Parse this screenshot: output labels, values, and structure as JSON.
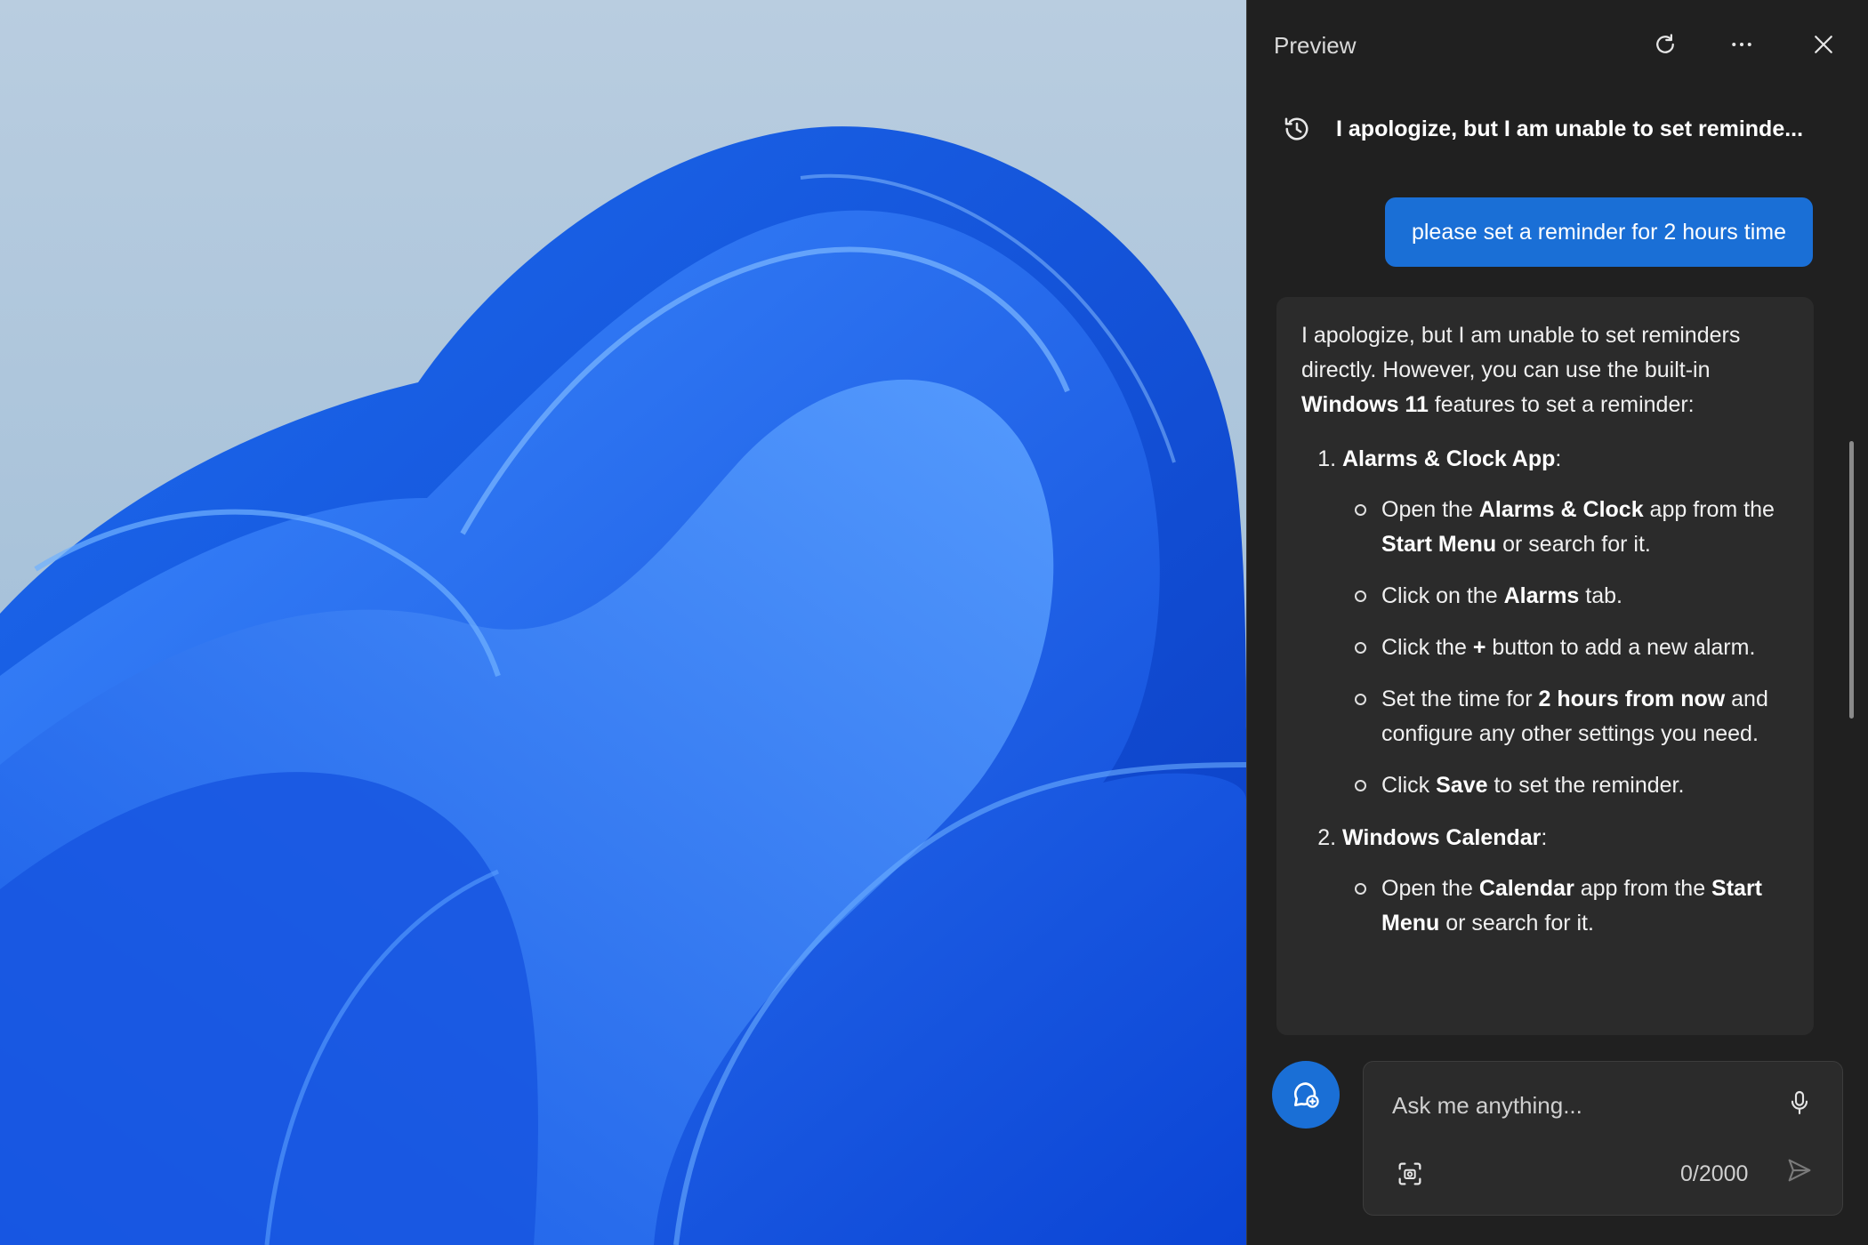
{
  "desktop": {
    "wallpaper": "windows-11-bloom-wallpaper"
  },
  "panel": {
    "title": "Preview",
    "icons": {
      "refresh": "refresh-icon",
      "more": "more-options-icon",
      "close": "close-icon",
      "history": "history-icon"
    },
    "topic_title": "I apologize, but I am unable to set reminde...",
    "user_message": "please set a reminder for 2 hours time",
    "answer": {
      "intro_1": "I apologize, but I am unable to set reminders directly. However, you can use the built-in ",
      "intro_bold": "Windows 11",
      "intro_2": " features to set a reminder:",
      "section1": {
        "title": "Alarms & Clock App",
        "suffix": ":",
        "b1_a": "Open the ",
        "b1_b": "Alarms & Clock",
        "b1_c": " app from the ",
        "b1_d": "Start Menu",
        "b1_e": " or search for it.",
        "b2_a": "Click on the ",
        "b2_b": "Alarms",
        "b2_c": " tab.",
        "b3_a": "Click the ",
        "b3_b": "+",
        "b3_c": " button to add a new alarm.",
        "b4_a": "Set the time for ",
        "b4_b": "2 hours from now",
        "b4_c": " and configure any other settings you need.",
        "b5_a": "Click ",
        "b5_b": "Save",
        "b5_c": " to set the reminder."
      },
      "section2": {
        "title": "Windows Calendar",
        "suffix": ":",
        "b1_a": "Open the ",
        "b1_b": "Calendar",
        "b1_c": " app from the ",
        "b1_d": "Start Menu",
        "b1_e": " or search for it."
      }
    },
    "input": {
      "placeholder": "Ask me anything...",
      "counter": "0/2000"
    },
    "accent_color": "#1a6fd6"
  }
}
